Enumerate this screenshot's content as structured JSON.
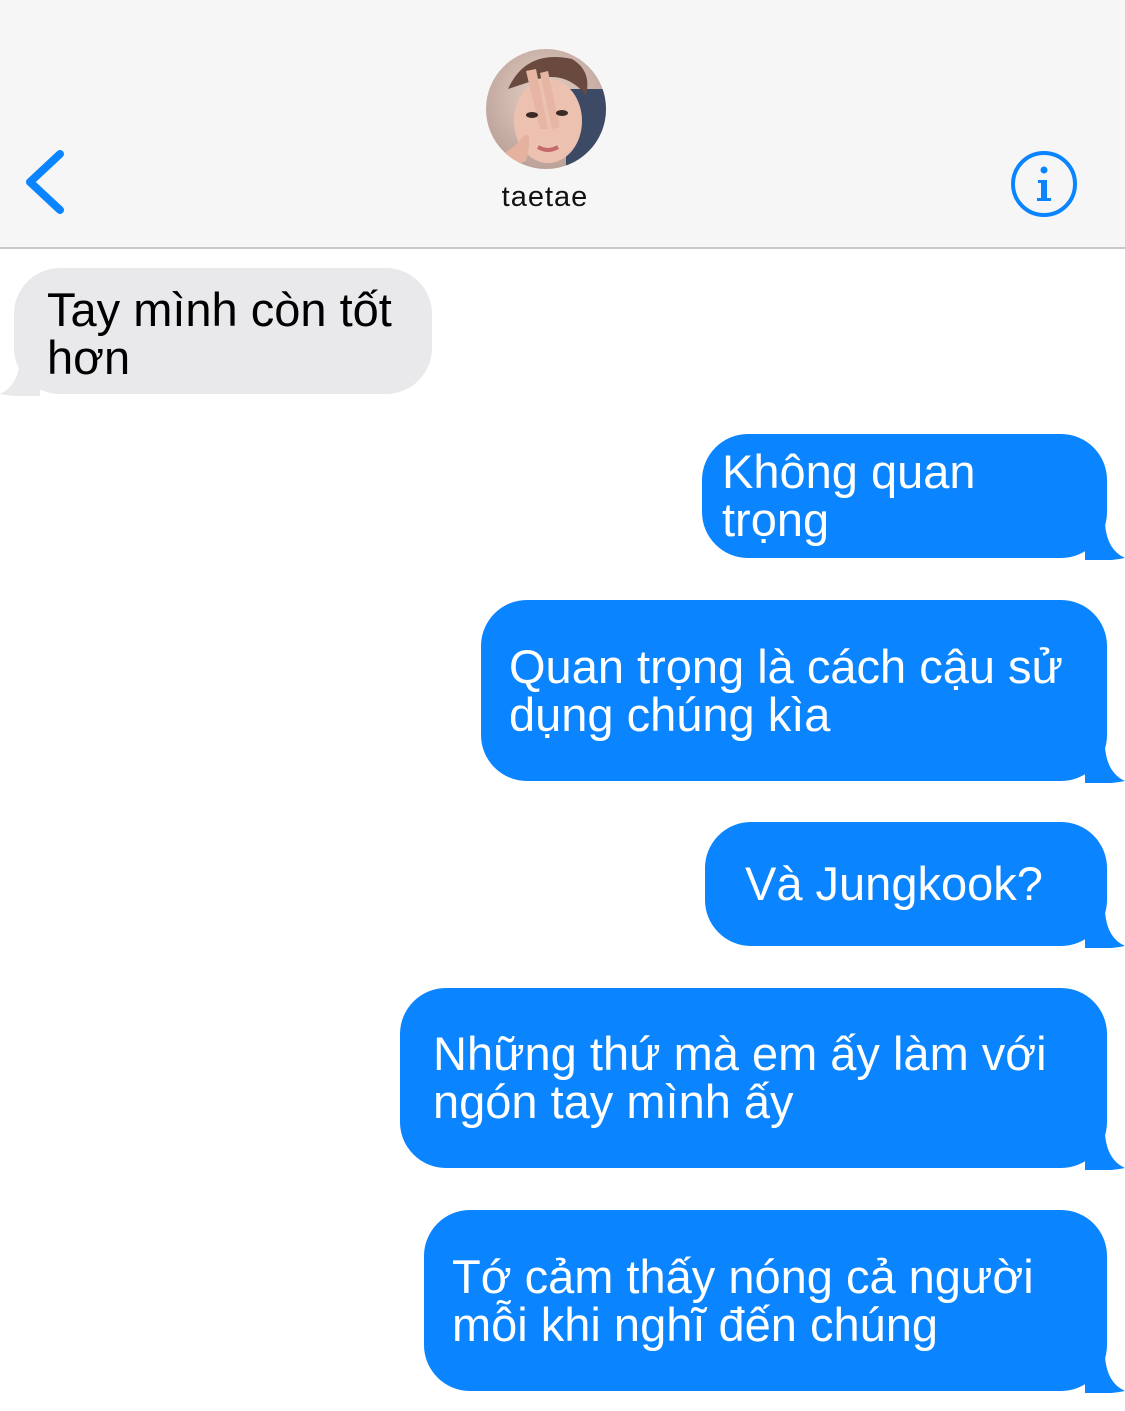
{
  "header": {
    "contact_name": "taetae",
    "accent_color": "#0a84ff",
    "back_icon": "chevron-left-icon",
    "info_icon": "info-circle-icon"
  },
  "messages": [
    {
      "from": "them",
      "text": "Tay mình còn tốt hơn"
    },
    {
      "from": "me",
      "text": "Không quan trọng"
    },
    {
      "from": "me",
      "text": "Quan trọng là cách cậu sử dụng chúng kìa"
    },
    {
      "from": "me",
      "text": "Và Jungkook?"
    },
    {
      "from": "me",
      "text": "Những thứ mà em ấy làm với ngón tay mình ấy"
    },
    {
      "from": "me",
      "text": "Tớ cảm thấy nóng cả người mỗi khi nghĩ đến chúng"
    }
  ]
}
